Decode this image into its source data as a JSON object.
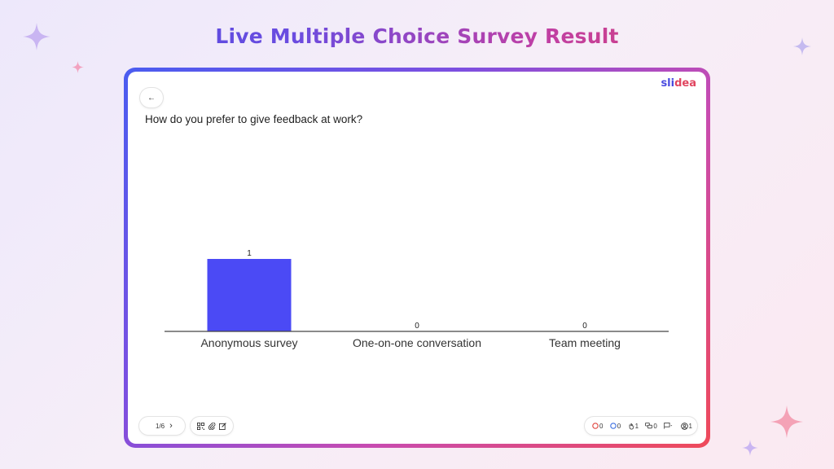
{
  "header": {
    "title": "Live Multiple Choice Survey Result"
  },
  "brand": {
    "part1": "sli",
    "part2": "dea"
  },
  "colors": {
    "bar": "#4b4af5",
    "brand_blue": "#4a4be0",
    "brand_red": "#e0455f"
  },
  "question": "How do you prefer to give feedback at work?",
  "back_button": {
    "icon": "arrow-left-icon",
    "glyph": "←"
  },
  "chart_data": {
    "type": "bar",
    "categories": [
      "Anonymous survey",
      "One-on-one conversation",
      "Team meeting"
    ],
    "values": [
      1,
      0,
      0
    ],
    "value_labels": [
      "1",
      "0",
      "0"
    ],
    "title": "",
    "xlabel": "",
    "ylabel": "",
    "ylim": [
      0,
      1
    ],
    "grid": false,
    "legend": "none"
  },
  "footer": {
    "slide_counter": "1/6",
    "next_glyph": "›",
    "tools": [
      "qr-code-icon",
      "attachment-icon",
      "edit-icon"
    ],
    "stats": [
      {
        "icon": "dislike-icon",
        "value": "0",
        "color": "#e0453f"
      },
      {
        "icon": "like-icon",
        "value": "0",
        "color": "#3d6fe0"
      },
      {
        "icon": "raised-hand-icon",
        "value": "1",
        "color": "#333333"
      },
      {
        "icon": "chat-bubbles-icon",
        "value": "0",
        "color": "#333333"
      },
      {
        "icon": "flag-icon",
        "value": "",
        "color": "#333333"
      },
      {
        "icon": "participants-icon",
        "value": "1",
        "color": "#333333"
      }
    ]
  }
}
